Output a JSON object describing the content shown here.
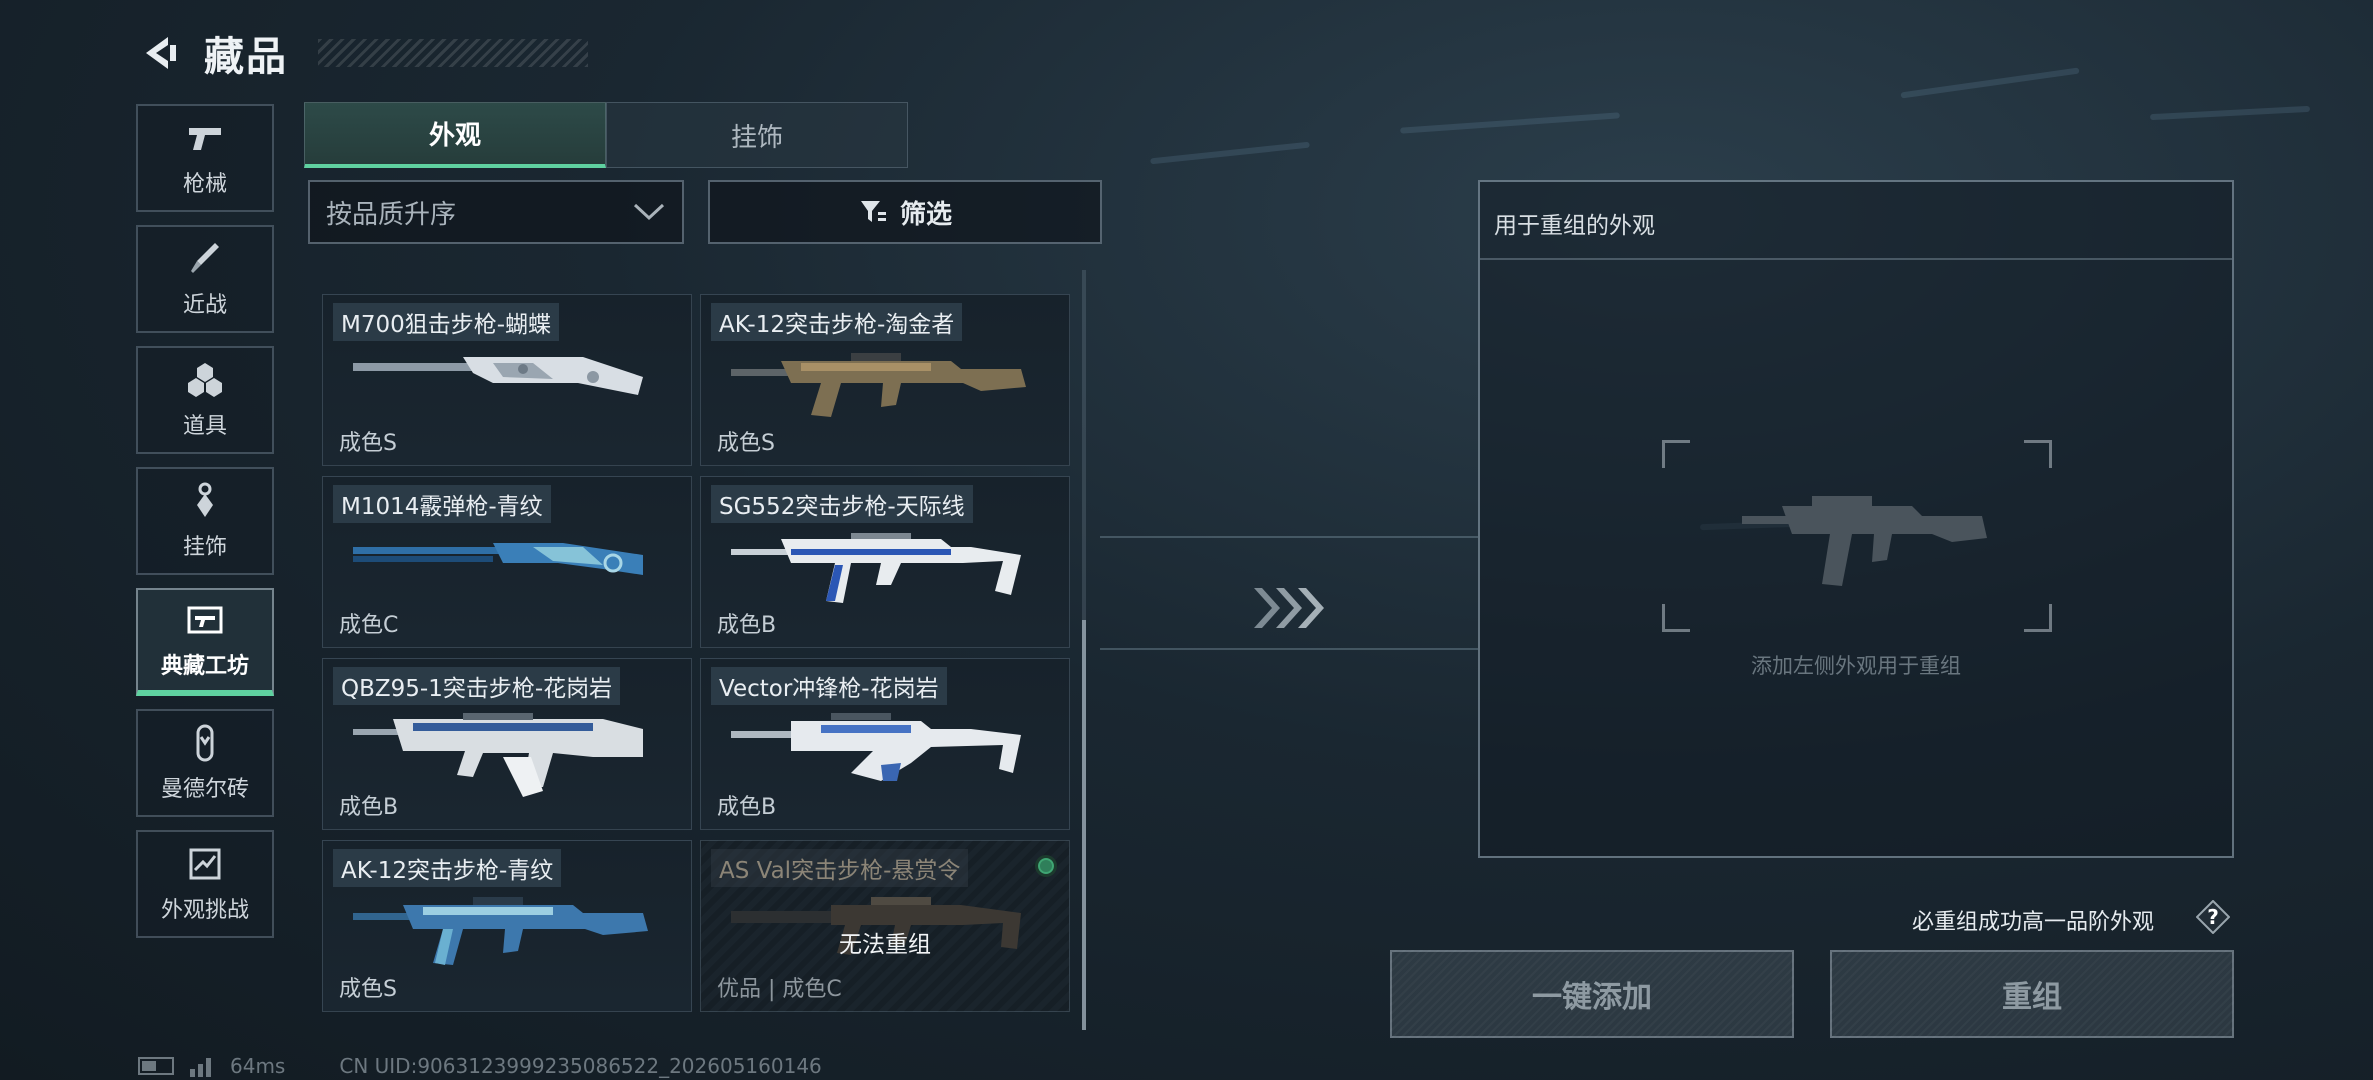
{
  "header": {
    "title": "藏品"
  },
  "nav": {
    "items": [
      {
        "label": "枪械",
        "icon": "pistol-icon",
        "active": false
      },
      {
        "label": "近战",
        "icon": "knife-icon",
        "active": false
      },
      {
        "label": "道具",
        "icon": "grenade-cluster-icon",
        "active": false
      },
      {
        "label": "挂饰",
        "icon": "keychain-icon",
        "active": false
      },
      {
        "label": "典藏工坊",
        "icon": "gun-frame-icon",
        "active": true
      },
      {
        "label": "曼德尔砖",
        "icon": "capsule-icon",
        "active": false
      },
      {
        "label": "外观挑战",
        "icon": "challenge-icon",
        "active": false
      }
    ]
  },
  "tabs": [
    {
      "label": "外观",
      "active": true
    },
    {
      "label": "挂饰",
      "active": false
    }
  ],
  "sort": {
    "value": "按品质升序"
  },
  "filter": {
    "label": "筛选"
  },
  "cards": [
    {
      "name": "M700狙击步枪-蝴蝶",
      "grade": "成色S"
    },
    {
      "name": "AK-12突击步枪-淘金者",
      "grade": "成色S"
    },
    {
      "name": "M1014霰弹枪-青纹",
      "grade": "成色C"
    },
    {
      "name": "SG552突击步枪-天际线",
      "grade": "成色B"
    },
    {
      "name": "QBZ95-1突击步枪-花岗岩",
      "grade": "成色B"
    },
    {
      "name": "Vector冲锋枪-花岗岩",
      "grade": "成色B"
    },
    {
      "name": "AK-12突击步枪-青纹",
      "grade": "成色S"
    },
    {
      "name": "AS Val突击步枪-悬赏令",
      "grade": "优品 | 成色C",
      "status": "无法重组"
    }
  ],
  "recombine": {
    "header": "用于重组的外观",
    "hint": "添加左侧外观用于重组"
  },
  "guarantee": "必重组成功高一品阶外观",
  "buttons": {
    "add_all": "一键添加",
    "recombine": "重组"
  },
  "footer": {
    "ping": "64ms",
    "uid": "CN UID:9063123999235086522_202605160146"
  },
  "colors": {
    "accent": "#5fd1a0",
    "panel_border": "#a0b4c3"
  }
}
